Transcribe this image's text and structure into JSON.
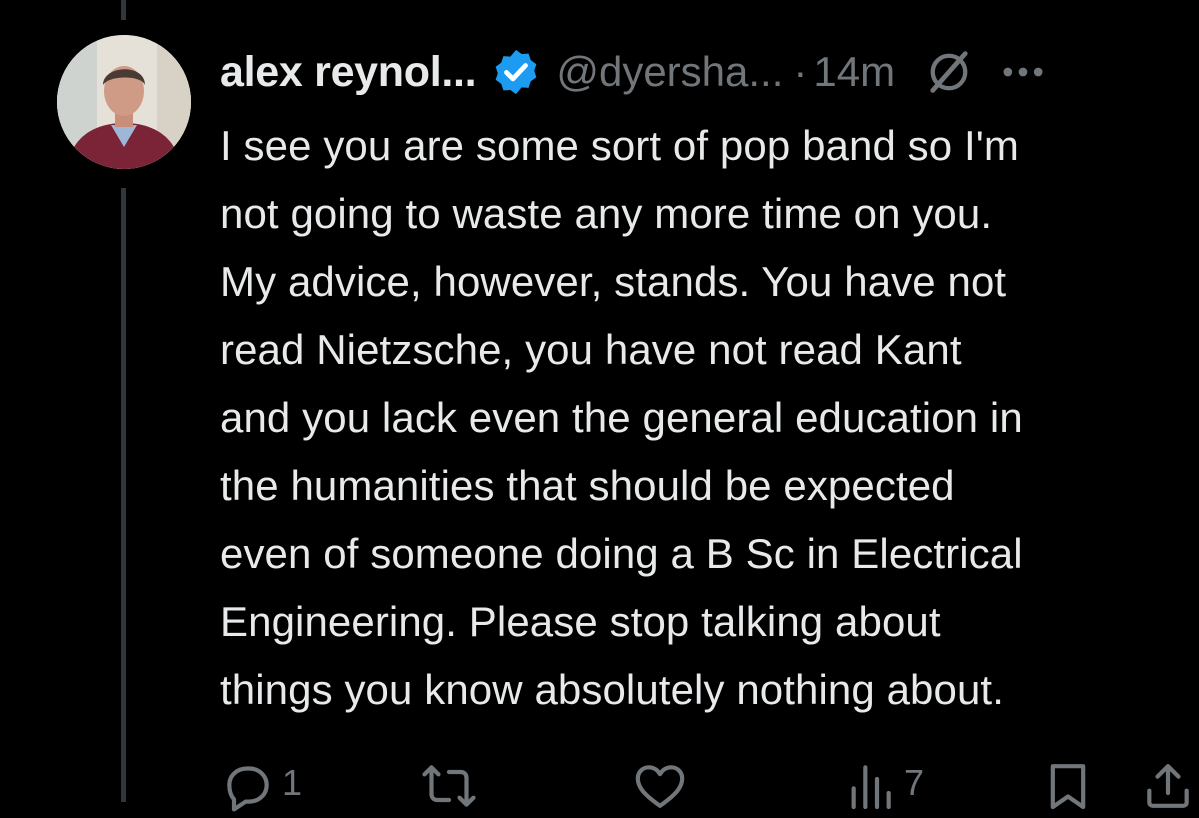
{
  "tweet": {
    "author_name": "alex reynol...",
    "handle": "@dyersha...",
    "separator": "·",
    "time": "14m",
    "text_lines": [
      "I see you are some sort of pop band so I'm",
      "not going to waste any more time on you.",
      "My advice, however, stands. You have not",
      "read Nietzsche, you have not read Kant",
      "and you lack even the general education in",
      "the humanities that should be expected",
      "even of someone doing a B Sc in Electrical",
      "Engineering. Please stop talking about",
      "things you know absolutely nothing about."
    ],
    "verified_color": "#1d9bf0"
  },
  "actions": {
    "reply_count": "1",
    "retweet_count": "",
    "like_count": "",
    "views_count": "7"
  },
  "icons": {
    "verified": "verified-badge-icon",
    "grok": "grok-icon",
    "more": "more-icon",
    "reply": "reply-icon",
    "retweet": "retweet-icon",
    "like": "like-icon",
    "views": "views-icon",
    "bookmark": "bookmark-icon",
    "share": "share-icon"
  }
}
